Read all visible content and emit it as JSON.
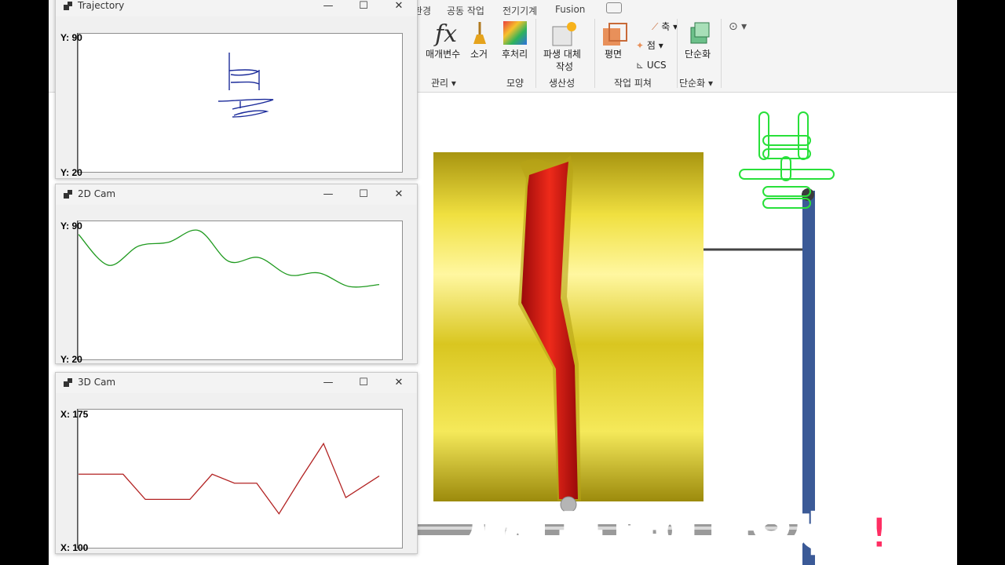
{
  "ribbon": {
    "tabs": [
      "환경",
      "공동 작업",
      "전기기계",
      "Fusion"
    ],
    "buttons": {
      "params": "매개변수",
      "purge": "소거",
      "post": "후처리",
      "derive": "파생 대체",
      "derive2": "작성",
      "plane": "평면",
      "axis": "축",
      "point": "점",
      "ucs": "UCS",
      "simplify": "단순화"
    },
    "groups": {
      "manage": "관리",
      "shape": "모양",
      "productivity": "생산성",
      "workfeature": "작업 피쳐",
      "simplify": "단순화"
    },
    "fx_glyph": "fx"
  },
  "windows": {
    "trajectory": {
      "title": "Trajectory",
      "y_top": "Y: 90",
      "y_bottom": "Y: 20"
    },
    "cam2d": {
      "title": "2D Cam",
      "y_top": "Y: 90",
      "y_bottom": "Y: 20"
    },
    "cam3d": {
      "title": "3D Cam",
      "y_top": "X: 175",
      "y_bottom": "X: 100"
    },
    "controls": {
      "minimize": "—",
      "maximize": "☐",
      "close": "✕"
    }
  },
  "chart_data": [
    {
      "type": "line",
      "title": "Trajectory",
      "ylim": [
        20,
        90
      ],
      "series": [
        {
          "name": "",
          "color": "#1b2b9a",
          "shape": "handwritten glyph '복'"
        }
      ]
    },
    {
      "type": "line",
      "title": "2D Cam",
      "ylim": [
        20,
        90
      ],
      "x": [
        0,
        10,
        20,
        30,
        40,
        50,
        60,
        70,
        80,
        90,
        100
      ],
      "series": [
        {
          "name": "",
          "color": "#1f9a1f",
          "values": [
            84,
            68,
            78,
            80,
            86,
            70,
            72,
            63,
            64,
            57,
            58
          ]
        }
      ]
    },
    {
      "type": "line",
      "title": "3D Cam",
      "ylim": [
        100,
        175
      ],
      "x": [
        0,
        20,
        30,
        50,
        60,
        70,
        80,
        90,
        100,
        110,
        120,
        135
      ],
      "series": [
        {
          "name": "",
          "color": "#b22222",
          "values": [
            140,
            140,
            126,
            126,
            140,
            135,
            135,
            118,
            138,
            157,
            127,
            139
          ]
        }
      ]
    }
  ],
  "caption": "새해 복 많이 받으세요!"
}
